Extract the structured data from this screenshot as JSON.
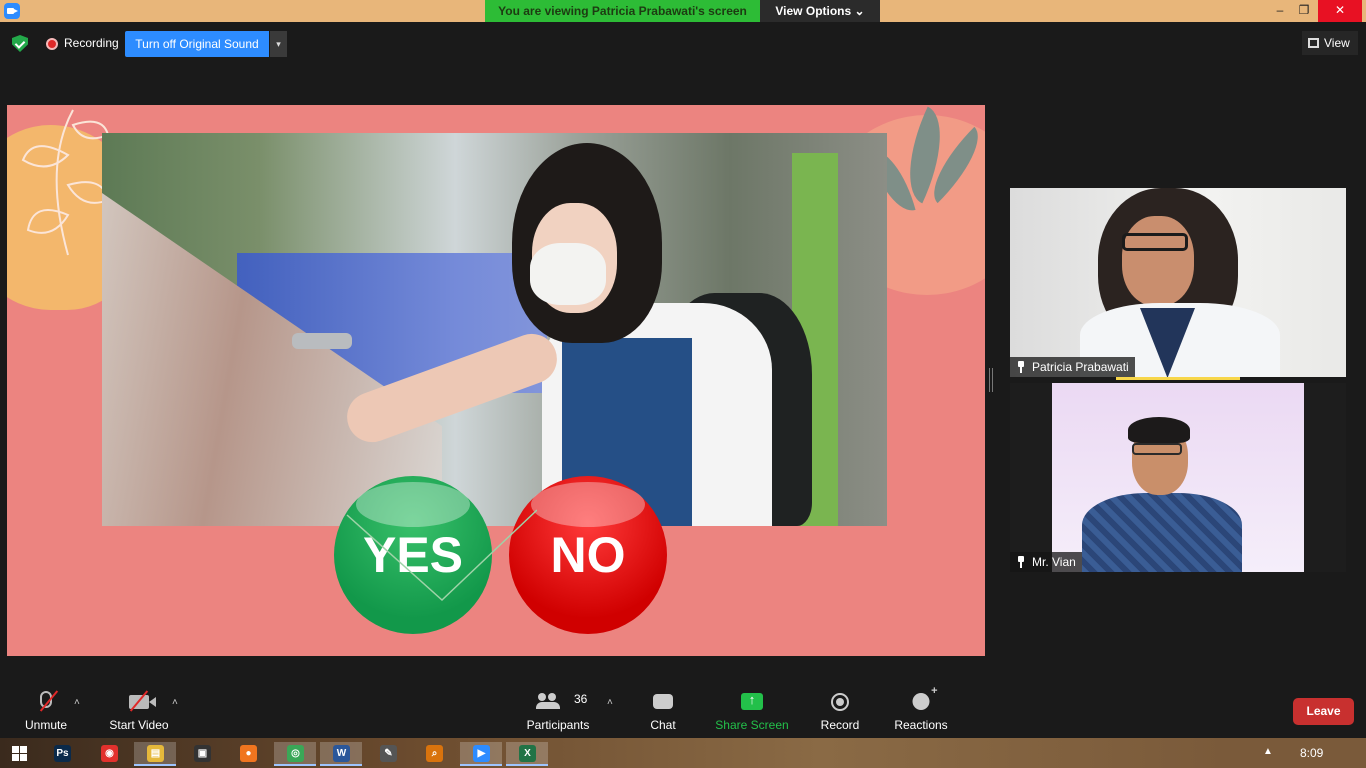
{
  "window": {
    "banner": "You are viewing Patricia Prabawati's screen",
    "view_options": "View Options",
    "min": "–",
    "restore": "❐",
    "close": "✕"
  },
  "topbar": {
    "recording_label": "Recording",
    "original_sound_label": "Turn off Original Sound",
    "dropdown_glyph": "▾",
    "view_label": "View"
  },
  "slide": {
    "yes_label": "YES",
    "no_label": "NO"
  },
  "participants": [
    {
      "name": "Patricia Prabawati",
      "active_speaker": true
    },
    {
      "name": "Mr. Vian",
      "active_speaker": false
    }
  ],
  "controls": {
    "unmute": "Unmute",
    "start_video": "Start Video",
    "participants": "Participants",
    "participant_count": "36",
    "chat": "Chat",
    "share_screen": "Share Screen",
    "record": "Record",
    "reactions": "Reactions",
    "leave": "Leave",
    "caret": "˄"
  },
  "colors": {
    "share_screen_text": "#23c04a",
    "leave_bg": "#c8302f",
    "banner_bg": "#2dbc36",
    "slide_bg": "#ec8480"
  },
  "taskbar": {
    "apps": [
      {
        "name": "photoshop",
        "glyph": "Ps",
        "color": "#0b2a4a",
        "active": false
      },
      {
        "name": "screen-recorder",
        "glyph": "◉",
        "color": "#e2312d",
        "active": false
      },
      {
        "name": "file-explorer",
        "glyph": "▤",
        "color": "#e5b83b",
        "active": true
      },
      {
        "name": "media-player",
        "glyph": "▣",
        "color": "#333333",
        "active": false
      },
      {
        "name": "firefox",
        "glyph": "●",
        "color": "#f0751f",
        "active": false
      },
      {
        "name": "chrome",
        "glyph": "◎",
        "color": "#3aa757",
        "active": true
      },
      {
        "name": "word",
        "glyph": "W",
        "color": "#2b579a",
        "active": true
      },
      {
        "name": "pen-tool",
        "glyph": "✎",
        "color": "#555555",
        "active": false
      },
      {
        "name": "search",
        "glyph": "⌕",
        "color": "#d9730d",
        "active": false
      },
      {
        "name": "zoom",
        "glyph": "▶",
        "color": "#2d8cff",
        "active": true
      },
      {
        "name": "excel",
        "glyph": "X",
        "color": "#217346",
        "active": true
      }
    ],
    "tray_up": "▲",
    "time": "8:09"
  }
}
